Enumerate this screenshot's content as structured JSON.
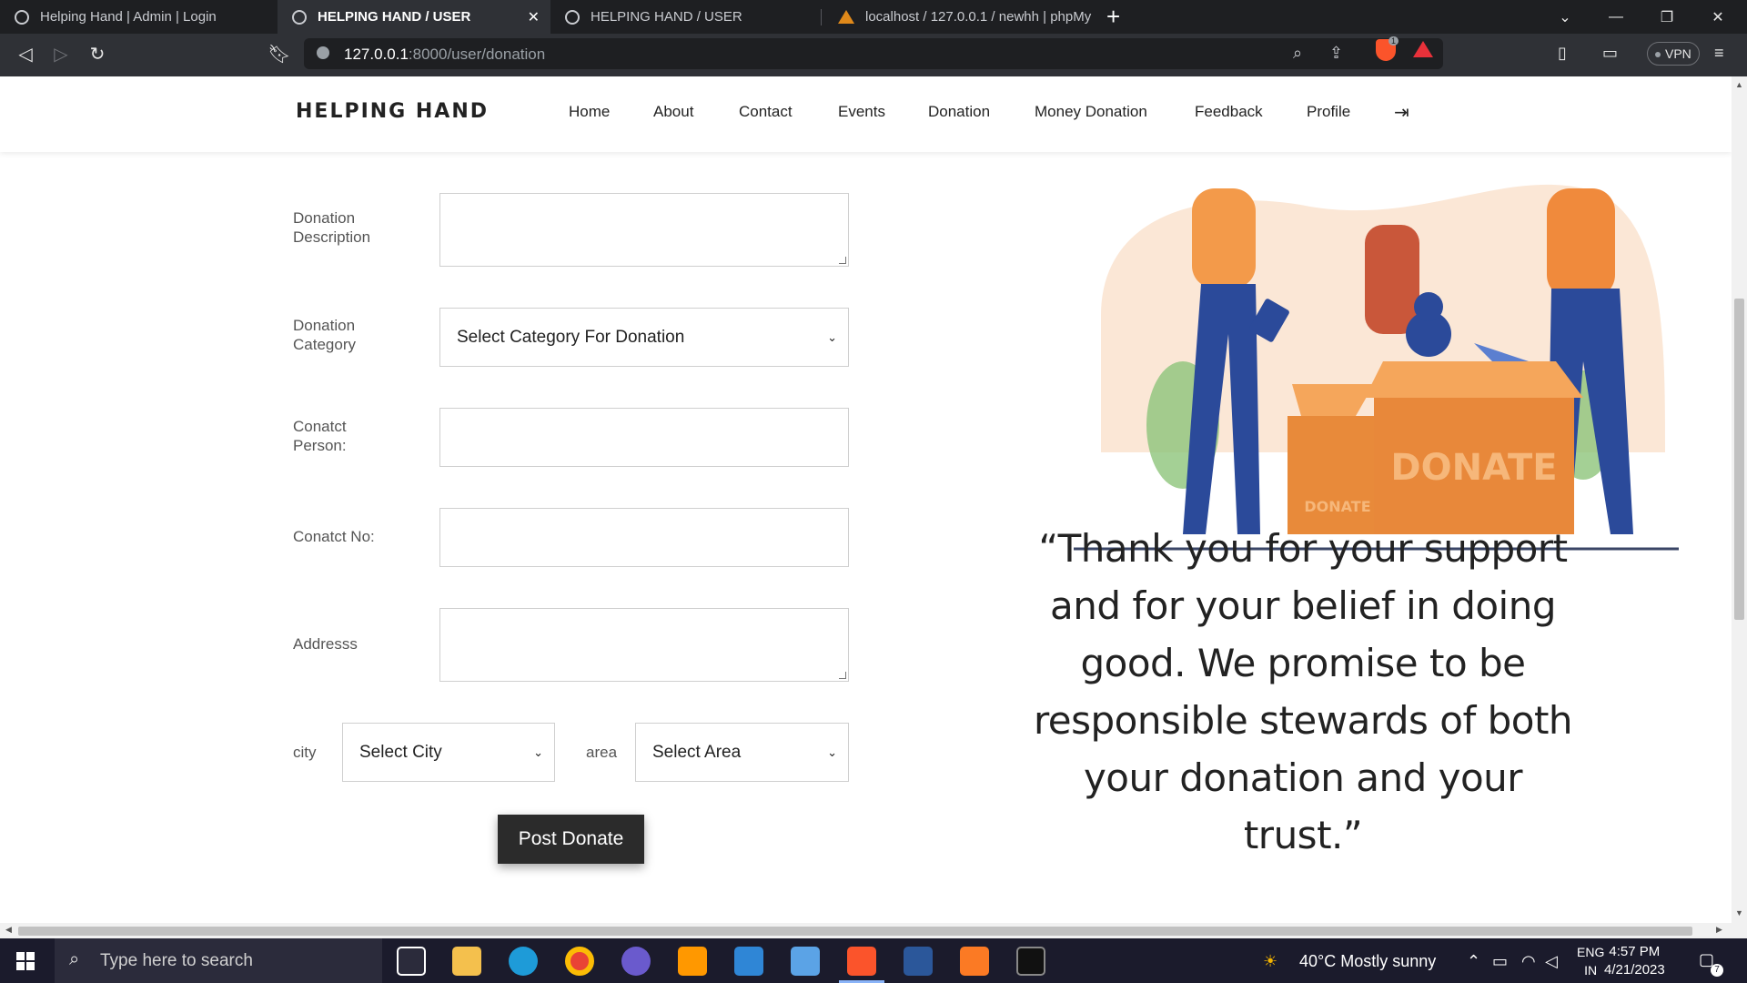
{
  "browser": {
    "tabs": [
      {
        "title": "Helping Hand | Admin | Login",
        "active": false
      },
      {
        "title": "HELPING HAND / USER",
        "active": true
      },
      {
        "title": "HELPING HAND / USER",
        "active": false
      },
      {
        "title": "localhost / 127.0.0.1 / newhh | phpMy",
        "active": false
      }
    ],
    "close_glyph": "✕",
    "new_tab_glyph": "+",
    "url_host": "127.0.0.1",
    "url_path": ":8000/user/donation",
    "brave_badge": "1",
    "vpn_label": "VPN",
    "window_controls": [
      "⌄",
      "—",
      "❐",
      "✕"
    ]
  },
  "site": {
    "brand": "HELPING HAND",
    "nav": [
      "Home",
      "About",
      "Contact",
      "Events",
      "Donation",
      "Money Donation",
      "Feedback",
      "Profile"
    ],
    "logout_icon": "logout-icon"
  },
  "form": {
    "description_label": "Donation Description",
    "category_label": "Donation Category",
    "category_selected": "Select Category For Donation",
    "contact_person_label": "Conatct Person:",
    "contact_no_label": "Conatct No:",
    "address_label": "Addresss",
    "city_label": "city",
    "city_selected": "Select City",
    "area_label": "area",
    "area_selected": "Select Area",
    "submit_label": "Post Donate"
  },
  "illustration": {
    "box_big": "DONATE",
    "box_small": "DONATE"
  },
  "quote": "“Thank you for your support and for your belief in doing good. We promise to be responsible stewards of both your donation and your trust.”",
  "taskbar": {
    "search_placeholder": "Type here to search",
    "weather": "40°C  Mostly sunny",
    "lang_top": "ENG",
    "lang_bottom": "IN",
    "time": "4:57 PM",
    "date": "4/21/2023",
    "notifications": "7"
  },
  "colors": {
    "accent_orange": "#f08a3c",
    "navy": "#1f3a7a",
    "button_dark": "#2b2b2b"
  }
}
